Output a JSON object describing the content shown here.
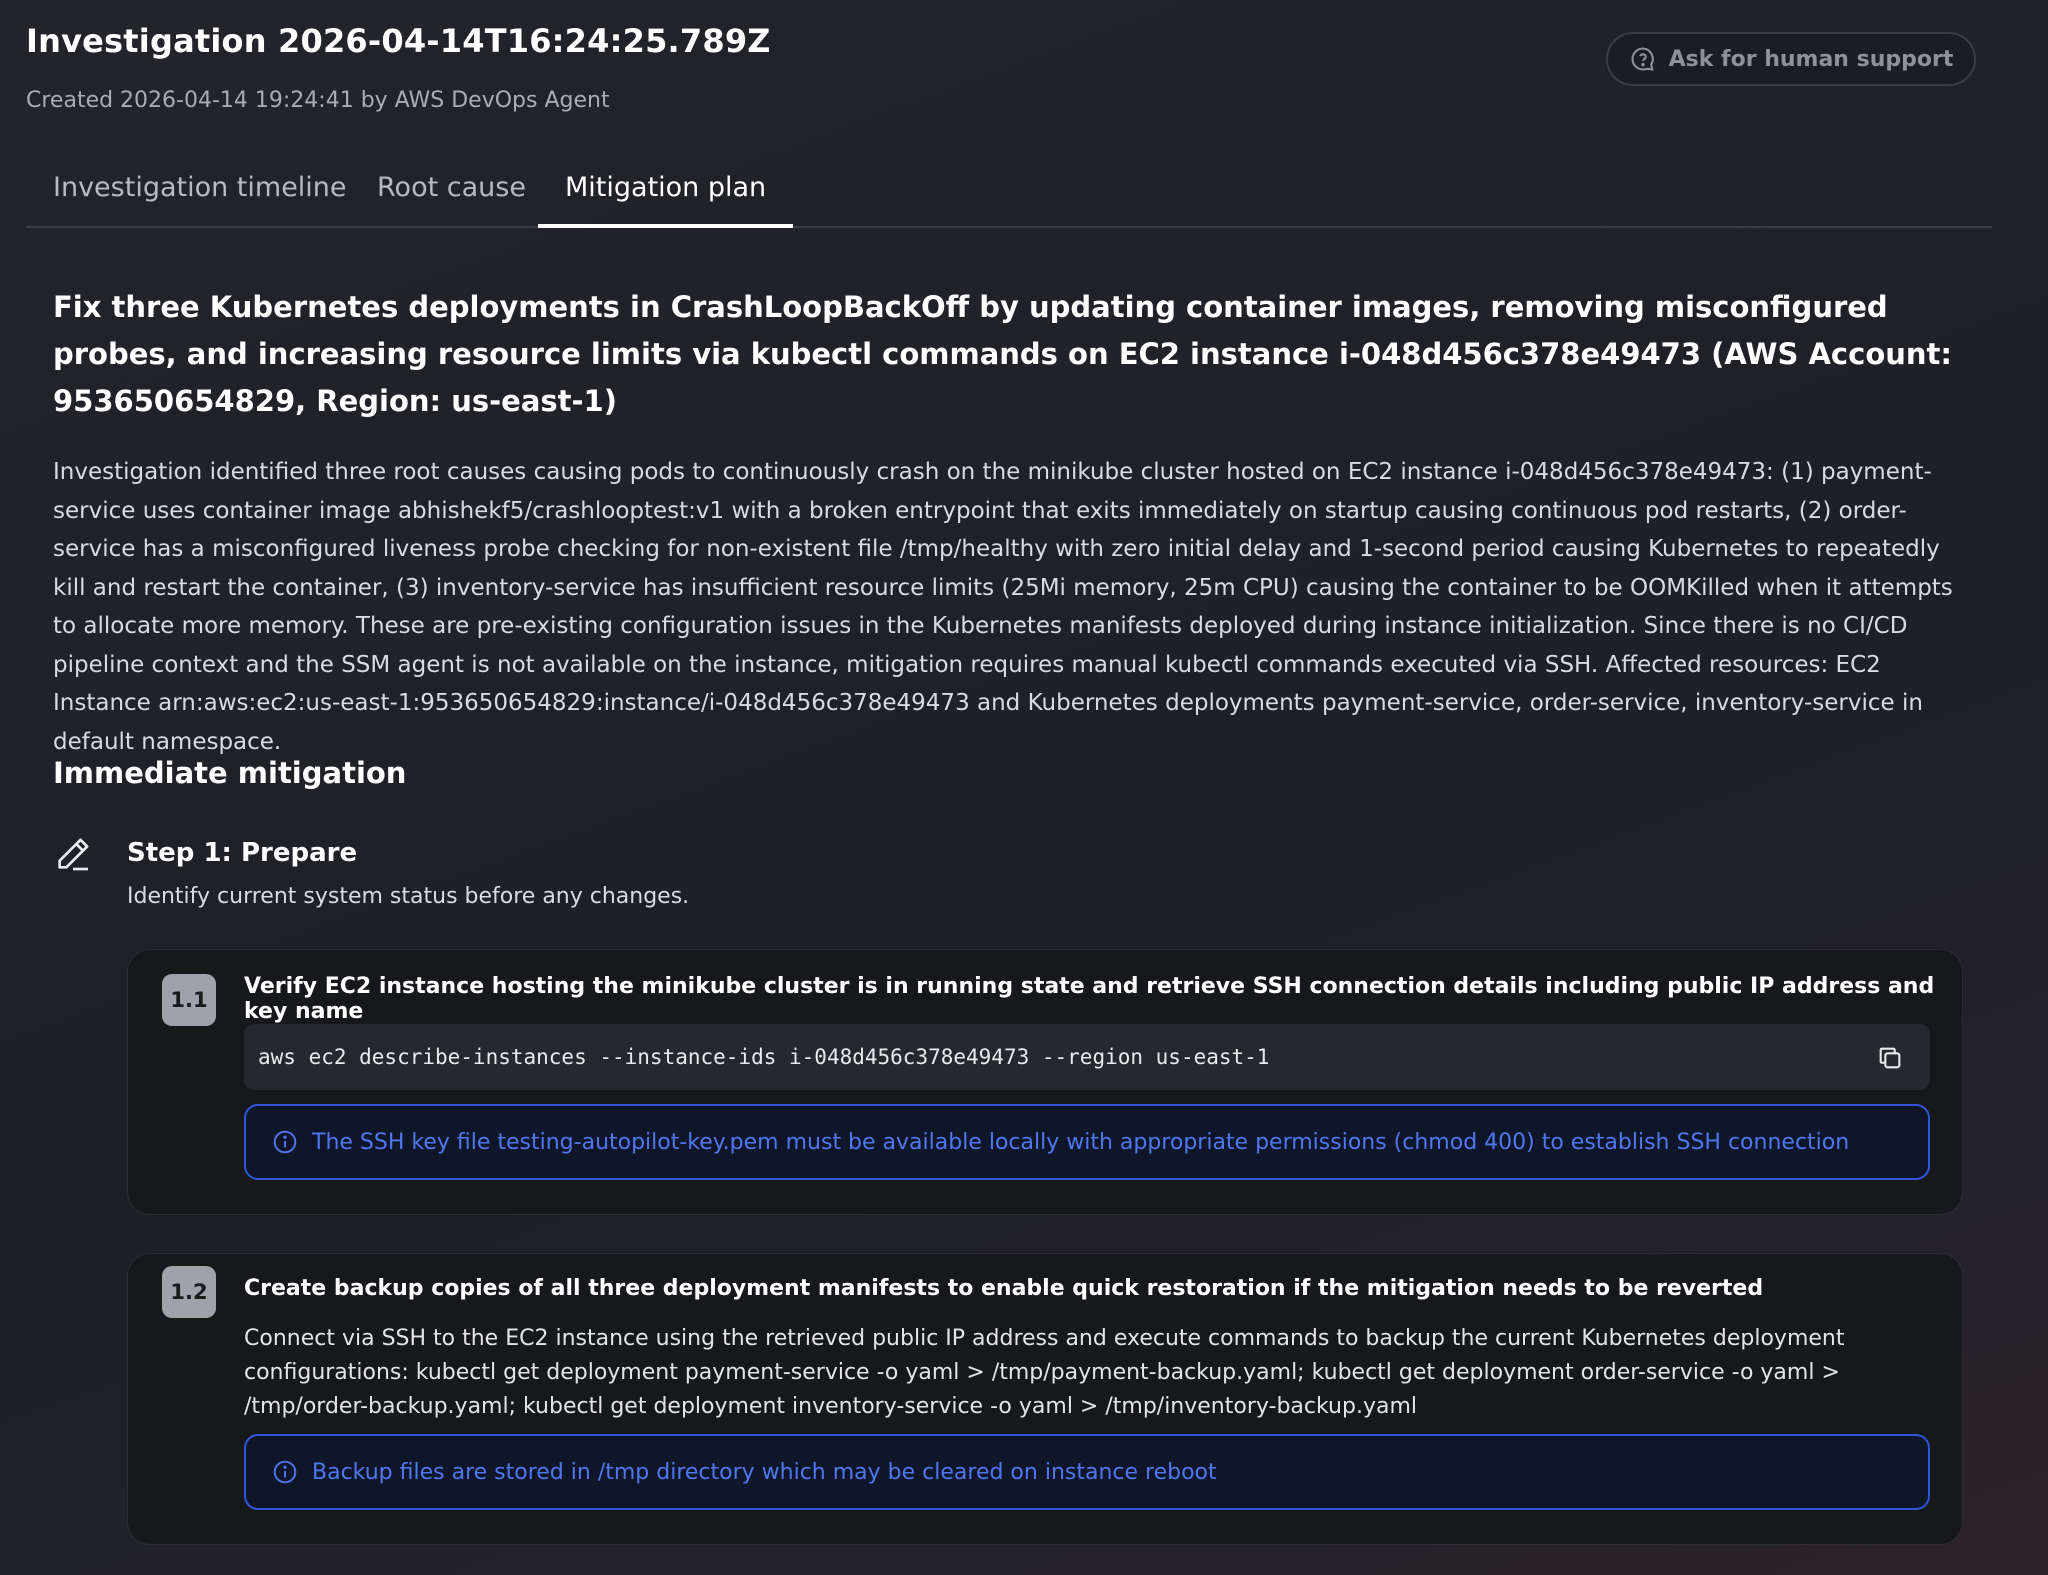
{
  "header": {
    "title": "Investigation 2026-04-14T16:24:25.789Z",
    "subtitle": "Created 2026-04-14 19:24:41 by AWS DevOps Agent",
    "support_button": "Ask for human support"
  },
  "tabs": [
    {
      "label": "Investigation timeline",
      "active": false
    },
    {
      "label": "Root cause",
      "active": false
    },
    {
      "label": "Mitigation plan",
      "active": true
    }
  ],
  "plan": {
    "headline": "Fix three Kubernetes deployments in CrashLoopBackOff by updating container images, removing misconfigured probes, and increasing resource limits via kubectl commands on EC2 instance i-048d456c378e49473 (AWS Account: 953650654829, Region: us-east-1)",
    "summary": "Investigation identified three root causes causing pods to continuously crash on the minikube cluster hosted on EC2 instance i-048d456c378e49473: (1) payment-service uses container image abhishekf5/crashlooptest:v1 with a broken entrypoint that exits immediately on startup causing continuous pod restarts, (2) order-service has a misconfigured liveness probe checking for non-existent file /tmp/healthy with zero initial delay and 1-second period causing Kubernetes to repeatedly kill and restart the container, (3) inventory-service has insufficient resource limits (25Mi memory, 25m CPU) causing the container to be OOMKilled when it attempts to allocate more memory. These are pre-existing configuration issues in the Kubernetes manifests deployed during instance initialization. Since there is no CI/CD pipeline context and the SSM agent is not available on the instance, mitigation requires manual kubectl commands executed via SSH. Affected resources: EC2 Instance arn:aws:ec2:us-east-1:953650654829:instance/i-048d456c378e49473 and Kubernetes deployments payment-service, order-service, inventory-service in default namespace.",
    "section_title": "Immediate mitigation",
    "step": {
      "title": "Step 1: Prepare",
      "description": "Identify current system status before any changes."
    },
    "substeps": [
      {
        "badge": "1.1",
        "title": "Verify EC2 instance hosting the minikube cluster is in running state and retrieve SSH connection details including public IP address and key name",
        "command": "aws ec2 describe-instances --instance-ids i-048d456c378e49473 --region us-east-1",
        "note": "The SSH key file testing-autopilot-key.pem must be available locally with appropriate permissions (chmod 400) to establish SSH connection"
      },
      {
        "badge": "1.2",
        "title": "Create backup copies of all three deployment manifests to enable quick restoration if the mitigation needs to be reverted",
        "text": "Connect via SSH to the EC2 instance using the retrieved public IP address and execute commands to backup the current Kubernetes deployment configurations: kubectl get deployment payment-service -o yaml > /tmp/payment-backup.yaml; kubectl get deployment order-service -o yaml > /tmp/order-backup.yaml; kubectl get deployment inventory-service -o yaml > /tmp/inventory-backup.yaml",
        "note": "Backup files are stored in /tmp directory which may be cleared on instance reboot"
      }
    ]
  },
  "colors": {
    "accent_info": "#4f77f0",
    "info_border": "#2f56d8",
    "badge_bg": "#9fa2aa"
  }
}
